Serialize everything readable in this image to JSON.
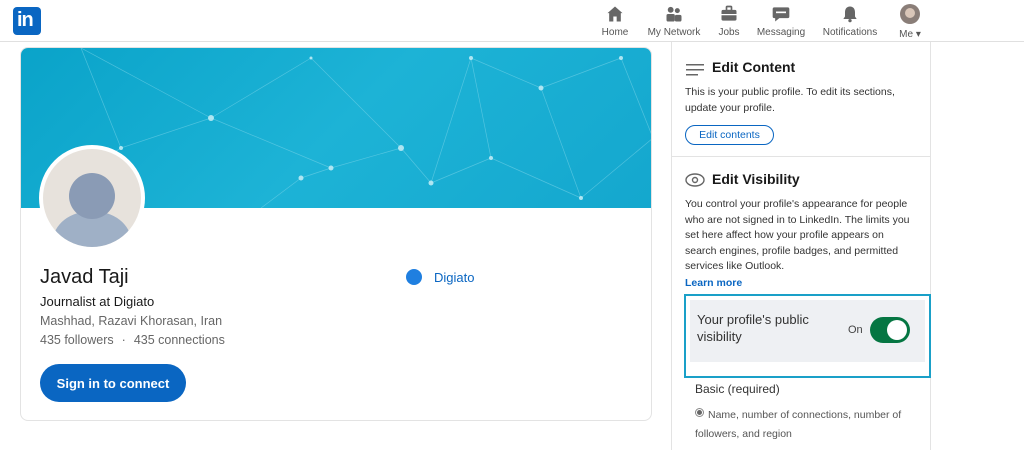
{
  "nav": {
    "logo_text": "in",
    "items": [
      {
        "label": "Home",
        "icon": "home-icon"
      },
      {
        "label": "My Network",
        "icon": "network-icon"
      },
      {
        "label": "Jobs",
        "icon": "briefcase-icon"
      },
      {
        "label": "Messaging",
        "icon": "messaging-icon"
      },
      {
        "label": "Notifications",
        "icon": "bell-icon"
      },
      {
        "label": "Me",
        "icon": "avatar"
      }
    ]
  },
  "profile": {
    "name": "Javad Taji",
    "headline": "Journalist at Digiato",
    "location": "Mashhad, Razavi Khorasan, Iran",
    "followers": "435 followers",
    "separator": "·",
    "connections": "435 connections",
    "company": "Digiato",
    "signin_label": "Sign in to connect"
  },
  "side": {
    "edit_content": {
      "title": "Edit Content",
      "text": "This is your public profile. To edit its sections, update your profile.",
      "button": "Edit contents"
    },
    "edit_visibility": {
      "title": "Edit Visibility",
      "text": "You control your profile's appearance for people who are not signed in to LinkedIn. The limits you set here affect how your profile appears on search engines, profile badges, and permitted services like Outlook.",
      "learn_more": "Learn more"
    },
    "public_visibility": {
      "label": "Your profile's public visibility",
      "state": "On"
    },
    "basic": {
      "title": "Basic (required)",
      "desc": "Name, number of connections, number of followers, and region"
    }
  },
  "colors": {
    "brand": "#0a66c2",
    "toggle_on": "#057642",
    "highlight": "#1aa0c8"
  }
}
